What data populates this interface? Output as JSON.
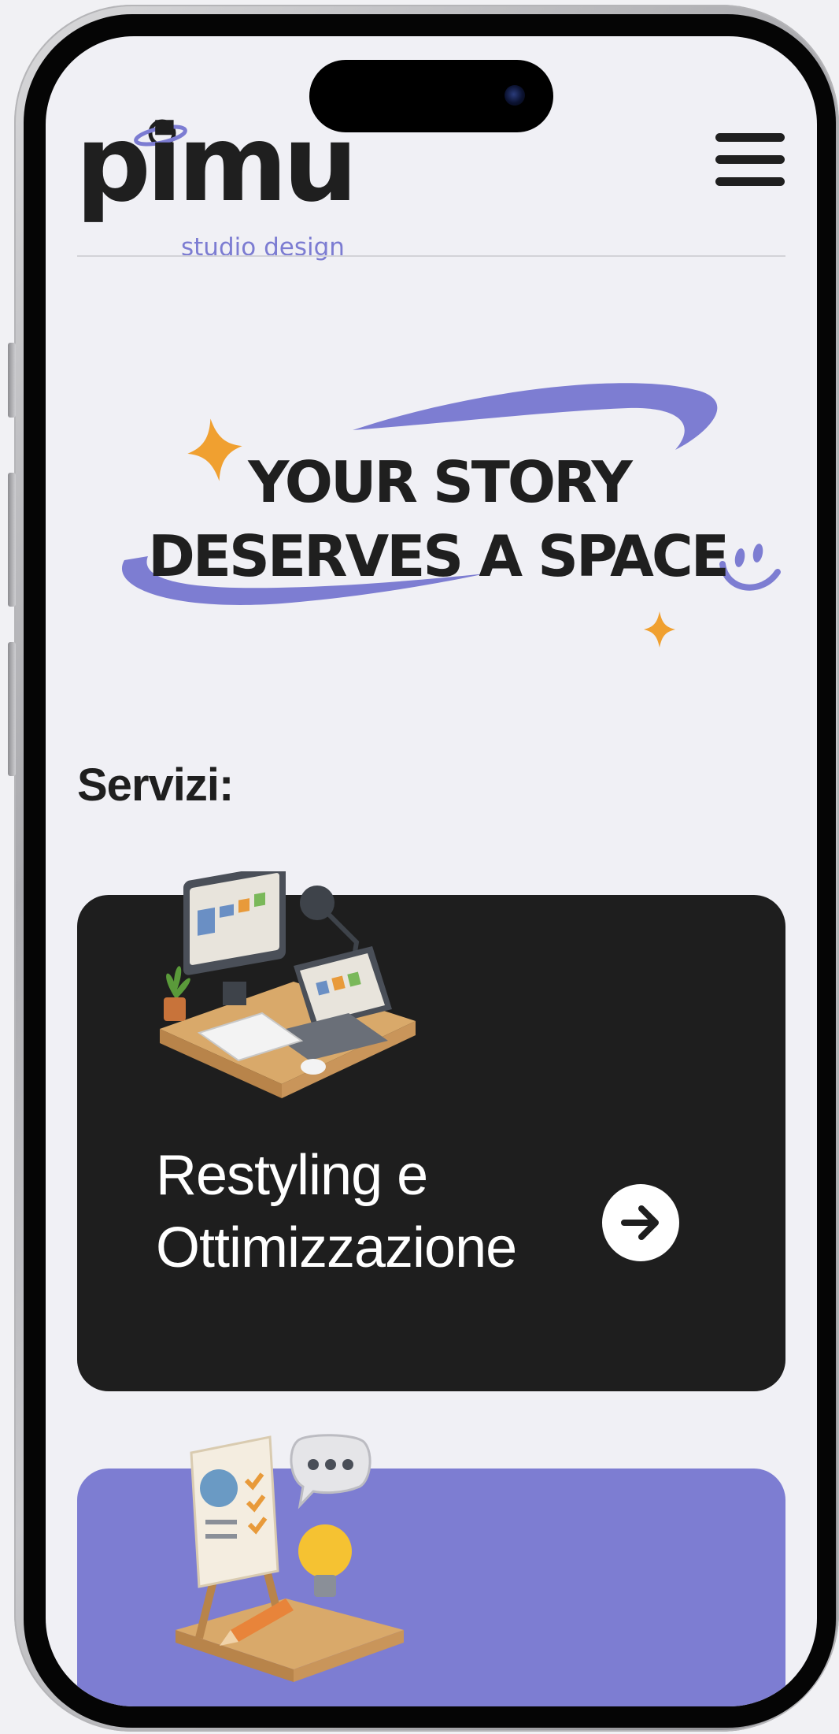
{
  "logo": {
    "wordmark": "pimu",
    "tagline": "studio design"
  },
  "header": {
    "menu_icon": "hamburger-menu-icon"
  },
  "hero": {
    "line1": "YOUR STORY",
    "line2": "DESERVES A SPACE"
  },
  "services": {
    "title": "Servizi:",
    "cards": [
      {
        "title_line1": "Restyling e",
        "title_line2": "Ottimizzazione",
        "icon": "desk-computer-illustration",
        "action_icon": "arrow-right-icon",
        "background": "#1e1e1e"
      },
      {
        "icon": "presentation-easel-illustration",
        "background": "#7d7dd2"
      }
    ]
  },
  "colors": {
    "accent_purple": "#7d7dd2",
    "accent_orange": "#f0a030",
    "text_dark": "#1f1f1f",
    "background": "#f0f0f5"
  }
}
